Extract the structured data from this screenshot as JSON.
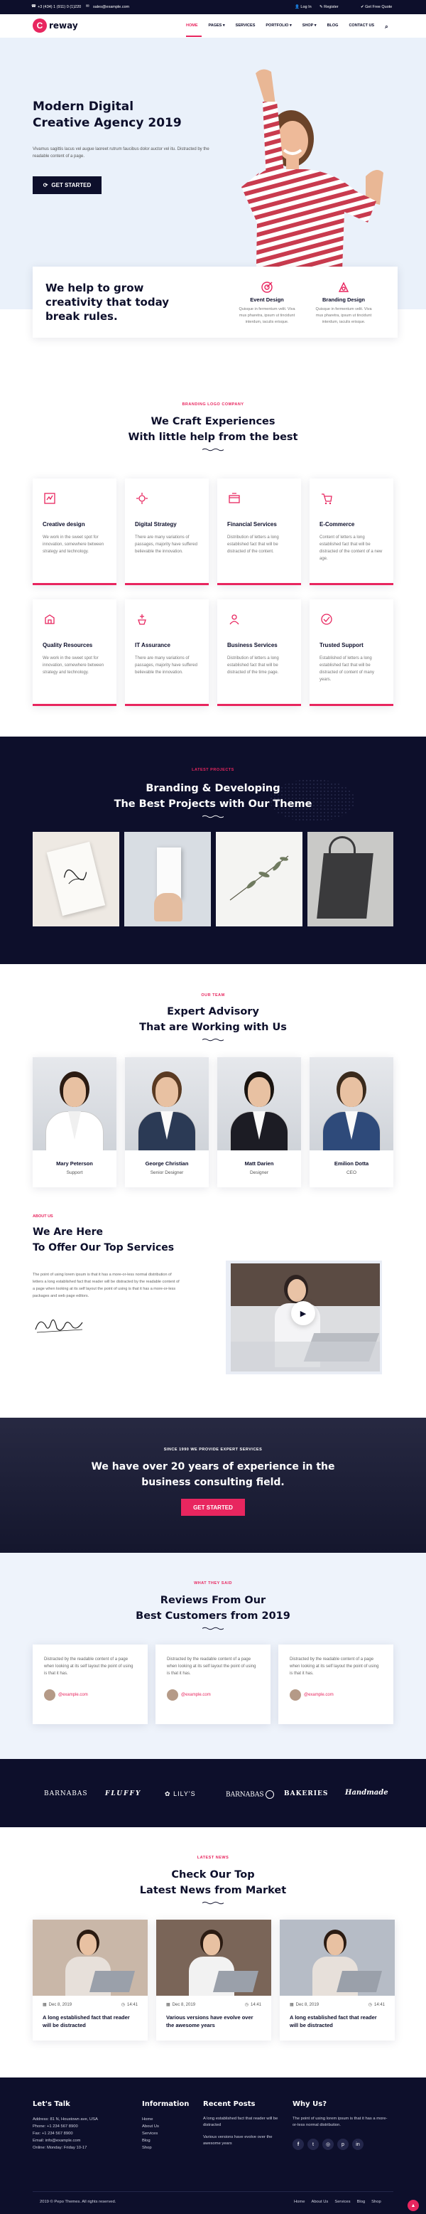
{
  "topbar": {
    "phone": "+3 (434) 1 (911) 0 (1)220",
    "email": "sales@example.com",
    "login": "Log In",
    "register": "Register",
    "quote": "Get Free Quote"
  },
  "nav": {
    "logo_text": "reway",
    "items": [
      "HOME",
      "PAGES",
      "SERVICES",
      "PORTFOLIO",
      "SHOP",
      "BLOG",
      "CONTACT US"
    ]
  },
  "hero": {
    "title_line1": "Modern Digital",
    "title_line2": "Creative Agency 2019",
    "text": "Vivamus sagittis lacus vel augue laoreet rutrum faucibus dolor auctor vel itu. Distracted by the readable content of a page.",
    "button": "GET STARTED"
  },
  "help": {
    "heading": "We help to grow creativity that today break rules.",
    "items": [
      {
        "title": "Event Design",
        "text": "Quisque in fermentum velit. Viva mus pharetra, ipsum ut tincidunt interdum, iaculis erisque."
      },
      {
        "title": "Branding Design",
        "text": "Quisque in fermentum velit. Viva mus pharetra, ipsum ut tincidunt interdum, iaculis erisque."
      }
    ]
  },
  "services": {
    "tag": "BRANDING LOGO COMPANY",
    "title_line1": "We Craft Experiences",
    "title_line2": "With little help from the best",
    "items": [
      {
        "title": "Creative design",
        "text": "We work in the sweet spot for innovation, somewhere between strategy and technology."
      },
      {
        "title": "Digital Strategy",
        "text": "There are many variations of passages, majority have suffered believable the innovation."
      },
      {
        "title": "Financial Services",
        "text": "Distribution of letters a long established fact that will be distracted of the content."
      },
      {
        "title": "E-Commerce",
        "text": "Content of letters a long established fact that will be distracted of the content of a new age."
      },
      {
        "title": "Quality Resources",
        "text": "We work in the sweet spot for innovation, somewhere between strategy and technology."
      },
      {
        "title": "IT Assurance",
        "text": "There are many variations of passages, majority have suffered believable the innovation."
      },
      {
        "title": "Business Services",
        "text": "Distribution of letters a long established fact that will be distracted of the time page."
      },
      {
        "title": "Trusted Support",
        "text": "Established of letters a long established fact that will be distracted of content of many years."
      }
    ]
  },
  "projects": {
    "tag": "LATEST PROJECTS",
    "title_line1": "Branding & Developing",
    "title_line2": "The Best Projects with Our Theme"
  },
  "team": {
    "tag": "OUR TEAM",
    "title_line1": "Expert Advisory",
    "title_line2": "That are Working with Us",
    "members": [
      {
        "name": "Mary Peterson",
        "role": "Support"
      },
      {
        "name": "George Christian",
        "role": "Senior Designer"
      },
      {
        "name": "Matt Darien",
        "role": "Designer"
      },
      {
        "name": "Emilion Dotta",
        "role": "CEO"
      }
    ]
  },
  "about": {
    "tag": "ABOUT US",
    "title_line1": "We Are Here",
    "title_line2": "To Offer Our Top Services",
    "text": "The point of using lorem ipsum is that it has a more-or-less normal distribution of letters a long established fact that reader will be distracted by the readable content of a page when looking at its self layout the point of using is that it has a more-or-less packages and web page editors.",
    "signature": "Crowdfinity"
  },
  "experience": {
    "tag": "SINCE 1990 WE PROVIDE EXPERT SERVICES",
    "title_line1": "We have over 20 years of experience in the",
    "title_line2": "business consulting field.",
    "button": "GET STARTED"
  },
  "reviews": {
    "tag": "WHAT THEY SAID",
    "title_line1": "Reviews From Our",
    "title_line2": "Best Customers from 2019",
    "items": [
      {
        "text": "Distracted by the readable content of a page when looking at its self layout the point of using is that it has.",
        "email": "@example.com"
      },
      {
        "text": "Distracted by the readable content of a page when looking at its self layout the point of using is that it has.",
        "email": "@example.com"
      },
      {
        "text": "Distracted by the readable content of a page when looking at its self layout the point of using is that it has.",
        "email": "@example.com"
      }
    ]
  },
  "brands": [
    "BARNABAS",
    "FLUFFY",
    "LILY'S",
    "BARNABAS",
    "BAKERIES",
    "Handmade"
  ],
  "news": {
    "tag": "LATEST NEWS",
    "title_line1": "Check Our Top",
    "title_line2": "Latest News from Market",
    "items": [
      {
        "date": "Dec 8, 2019",
        "time": "14:41",
        "title": "A long established fact that reader will be distracted"
      },
      {
        "date": "Dec 8, 2019",
        "time": "14:41",
        "title": "Various versions have evolve over the awesome years"
      },
      {
        "date": "Dec 8, 2019",
        "time": "14:41",
        "title": "A long established fact that reader will be distracted"
      }
    ]
  },
  "footer": {
    "talk_title": "Let's Talk",
    "talk_lines": [
      "Address: 81 N, Houstown ave, USA",
      "Phone: +1 234 567 8900",
      "Fax: +1 234 567 8900",
      "Email: info@example.com",
      "Online: Monday: Friday 10-17"
    ],
    "info_title": "Information",
    "info_links": [
      "Home",
      "About Us",
      "Services",
      "Blog",
      "Shop"
    ],
    "posts_title": "Recent Posts",
    "posts": [
      "A long established fact that reader will be distracted",
      "Various versions have evolve over the awesome years"
    ],
    "why_title": "Why Us?",
    "why_text": "The point of using lorem ipsum is that it has a more-or-less normal distribution.",
    "copyright": "2019 © Pepo Themes. All rights reserved.",
    "bottom_links": [
      "Home",
      "About Us",
      "Services",
      "Blog",
      "Shop"
    ]
  },
  "colors": {
    "accent": "#e8265f",
    "dark": "#0d0f2b",
    "light_bg": "#eef3fb"
  }
}
